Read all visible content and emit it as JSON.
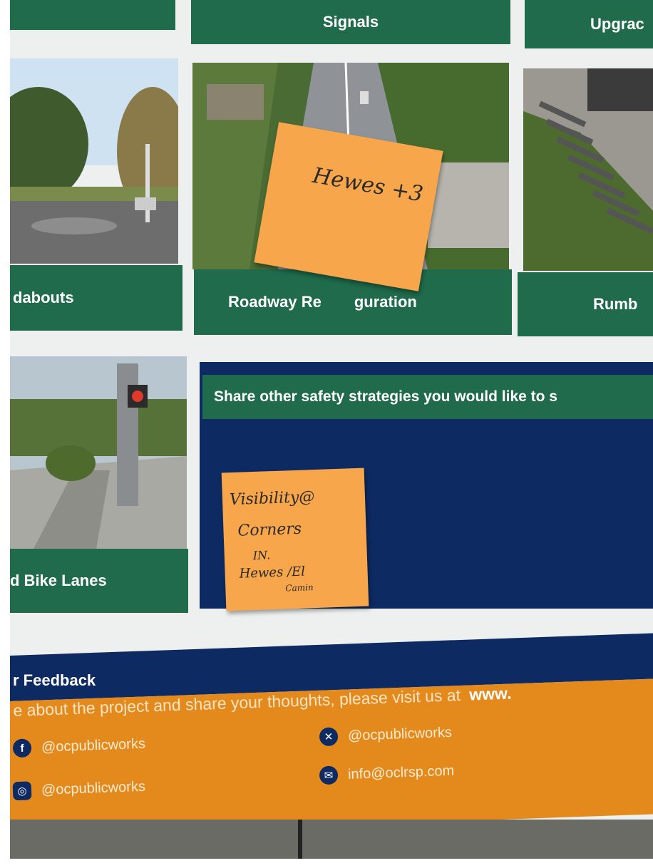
{
  "top_row": {
    "tile_center_label": "Signals",
    "tile_right_label": "Upgrac"
  },
  "middle_row": {
    "tile_left_label": "dabouts",
    "tile_center_label_left": "Roadway Re",
    "tile_center_label_right": "guration",
    "tile_right_label": "Rumb"
  },
  "bottom_row": {
    "tile_left_label": "d Bike Lanes",
    "prompt_banner": "Share other safety strategies you would like to s"
  },
  "sticky_notes": {
    "note_1": "Hewes +3",
    "note_2_line1": "Visibility@",
    "note_2_line2": "Corners",
    "note_2_line3": "IN.",
    "note_2_line4": "Hewes /El",
    "note_2_line5": "Camin"
  },
  "footer": {
    "heading": "r Feedback",
    "intro_text": "e about the project and share your thoughts, please visit us at",
    "intro_link": "www.",
    "socials": {
      "facebook": "@ocpublicworks",
      "instagram": "@ocpublicworks",
      "x": "@ocpublicworks",
      "email": "info@oclrsp.com"
    }
  },
  "colors": {
    "green": "#1f6b4c",
    "navy": "#0d2a63",
    "orange": "#e48a1d",
    "sticky": "#f7a64b"
  }
}
